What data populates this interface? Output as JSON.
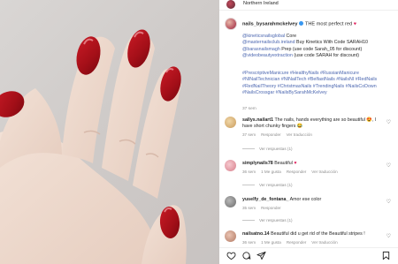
{
  "header": {
    "location": "Northern Ireland"
  },
  "post": {
    "username": "nails_bysarahmckelvey",
    "caption": "THE most perfect red",
    "lines": [
      {
        "link": "@kineticsnailsglobal",
        "text": " Core"
      },
      {
        "link": "@masternailsclub.ireland",
        "text": " Buy Kinetics With Code SARAH10"
      },
      {
        "link": "@barasnailsmagh",
        "text": " Prep (use code Sarah_05 for discount)"
      },
      {
        "link": "@videobeautyextraction",
        "text": " (use code SARAH for discount)"
      }
    ],
    "hashtags": "#PrescriptiveManicure #HealthyNails #RussianManicure #NINailTechnician #NINailTech #BelfastNails #NailsNI #RedNails #RedNailTheory #ChristmasNails #TrendingNails #NailsCoDown #NailsCrossgar #NailsBySarahMcKelvey",
    "time": "37 sem"
  },
  "comments": [
    {
      "username": "sallys.nailart1",
      "text": "The nails, hands everything are so beautiful 😍, I have short chunky fingers 😂",
      "time": "37 sem",
      "reply": "Responder",
      "translate": "Ver traducción",
      "replies": "Ver respuestas (1)"
    },
    {
      "username": "simplynails78",
      "text": "Beautiful",
      "time": "36 sem",
      "likes": "1 Me gusta",
      "reply": "Responder",
      "translate": "Ver traducción",
      "replies": "Ver respuestas (1)"
    },
    {
      "username": "yuselfy_de_fontana_",
      "text": "Amor ese color",
      "time": "35 sem",
      "reply": "Responder",
      "replies": "Ver respuestas (1)"
    },
    {
      "username": "nailsatno.14",
      "text": "Beautiful did u get rid of the Beautiful stripes !",
      "time": "36 sem",
      "likes": "1 Me gusta",
      "reply": "Responder",
      "translate": "Ver traducción"
    }
  ],
  "colors": {
    "link": "#4c67b0",
    "heart": "#e0245e",
    "nail": "#b5121b"
  },
  "icons": [
    "heart-icon",
    "comment-icon",
    "share-icon",
    "bookmark-icon"
  ]
}
